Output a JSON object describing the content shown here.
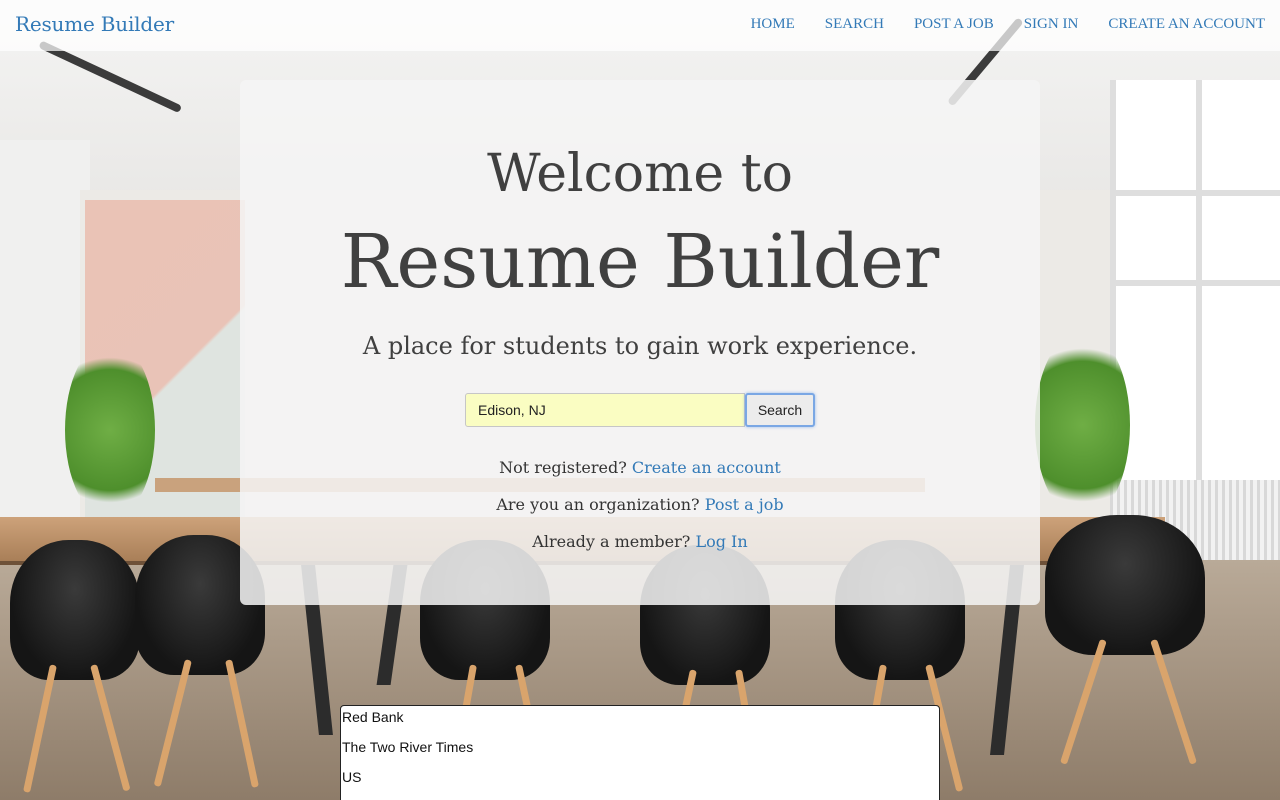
{
  "navbar": {
    "brand": "Resume Builder",
    "links": [
      "HOME",
      "SEARCH",
      "POST A JOB",
      "SIGN IN",
      "CREATE AN ACCOUNT"
    ]
  },
  "hero": {
    "welcome": "Welcome to",
    "title": "Resume Builder",
    "tagline": "A place for students to gain work experience."
  },
  "search": {
    "value": "Edison, NJ",
    "button_label": "Search"
  },
  "cta": {
    "register_text": "Not registered?",
    "register_link": "Create an account",
    "org_text": "Are you an organization?",
    "org_link": "Post a job",
    "member_text": "Already a member?",
    "member_link": "Log In"
  },
  "results": {
    "lines": [
      "Red Bank",
      "The Two River Times",
      "US"
    ]
  },
  "colors": {
    "link": "#337ab7",
    "input_bg": "#fafdc2",
    "hero_text": "#404040"
  }
}
